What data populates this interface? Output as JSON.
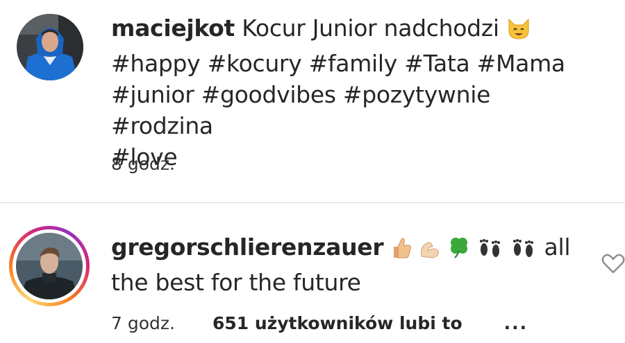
{
  "caption": {
    "username": "maciejkot",
    "text": "Kocur Junior nadchodzi",
    "emoji_icon": "cat-face-icon",
    "hashtags_line1": "#happy #kocury #family #Tata #Mama",
    "hashtags_line2": "#junior #goodvibes #pozytywnie #rodzina",
    "hashtags_line3": "#love",
    "time": "8 godz."
  },
  "comment": {
    "username": "gregorschlierenzauer",
    "emoji_icons": [
      "thumbs-up-icon",
      "flexed-biceps-icon",
      "four-leaf-clover-icon",
      "footprints-icon",
      "footprints-icon"
    ],
    "text_line1": "all",
    "text_line2": "the best for the future",
    "time": "7 godz.",
    "likes": "651 użytkowników lubi to",
    "more": "..."
  },
  "colors": {
    "text": "#262626",
    "divider": "#dbdbdb",
    "story_ring": [
      "#feda75",
      "#fa7e1e",
      "#d62976",
      "#962fbf"
    ]
  }
}
